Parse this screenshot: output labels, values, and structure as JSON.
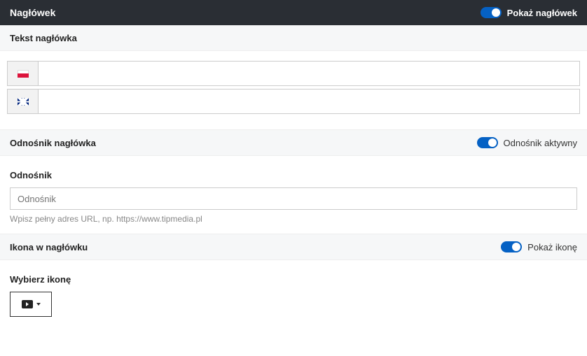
{
  "header": {
    "title": "Nagłówek",
    "toggle_label": "Pokaż nagłówek"
  },
  "text_section": {
    "label": "Tekst nagłówka",
    "inputs": {
      "pl": {
        "flag": "pl",
        "value": ""
      },
      "en": {
        "flag": "uk",
        "value": ""
      }
    }
  },
  "link_section": {
    "bar_label": "Odnośnik nagłówka",
    "toggle_label": "Odnośnik aktywny",
    "field_label": "Odnośnik",
    "placeholder": "Odnośnik",
    "helper": "Wpisz pełny adres URL, np. https://www.tipmedia.pl"
  },
  "icon_section": {
    "bar_label": "Ikona w nagłówku",
    "toggle_label": "Pokaż ikonę",
    "field_label": "Wybierz ikonę",
    "selected_icon": "youtube"
  }
}
